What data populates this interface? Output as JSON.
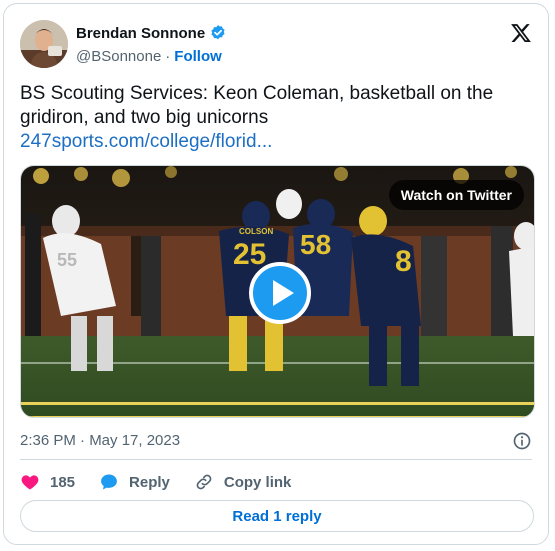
{
  "author": {
    "display_name": "Brendan Sonnone",
    "handle": "@BSonnone",
    "separator": "·",
    "follow_label": "Follow"
  },
  "tweet": {
    "text": "BS Scouting Services: Keon Coleman, basketball on the gridiron, and two big unicorns",
    "link": "247sports.com/college/florid..."
  },
  "media": {
    "watch_label": "Watch on Twitter",
    "jersey_numbers": [
      "25",
      "58",
      "8",
      "55"
    ],
    "jersey_name": "COLSON"
  },
  "meta": {
    "timestamp": "2:36 PM · May 17, 2023"
  },
  "actions": {
    "like_count": "185",
    "reply_label": "Reply",
    "copy_link_label": "Copy link"
  },
  "footer": {
    "read_replies_label": "Read 1 reply"
  },
  "colors": {
    "accent": "#1d9bf0",
    "link": "#006fd6",
    "like": "#f91880",
    "muted": "#536471"
  }
}
